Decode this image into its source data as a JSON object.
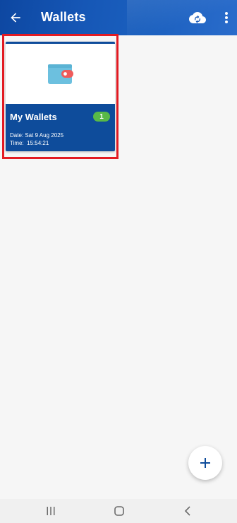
{
  "header": {
    "title": "Wallets",
    "back_icon": "arrow-left-icon",
    "sync_icon": "cloud-sync-icon",
    "more_icon": "more-vertical-icon"
  },
  "wallets": [
    {
      "name": "My Wallets",
      "count": "1",
      "date": "Date: Sat 9 Aug 2025",
      "time": "Time:  15:54:21",
      "icon": "wallet-icon"
    }
  ],
  "fab": {
    "label": "+",
    "icon": "plus-icon"
  },
  "nav": {
    "recents_icon": "recents-icon",
    "home_icon": "home-icon",
    "back_icon": "back-chevron-icon"
  },
  "colors": {
    "header": "#1657b6",
    "card": "#0e4c9b",
    "badge": "#58b947",
    "highlight": "#e31b23",
    "wallet_body": "#6cc0df",
    "wallet_clasp": "#ef5b5b"
  }
}
